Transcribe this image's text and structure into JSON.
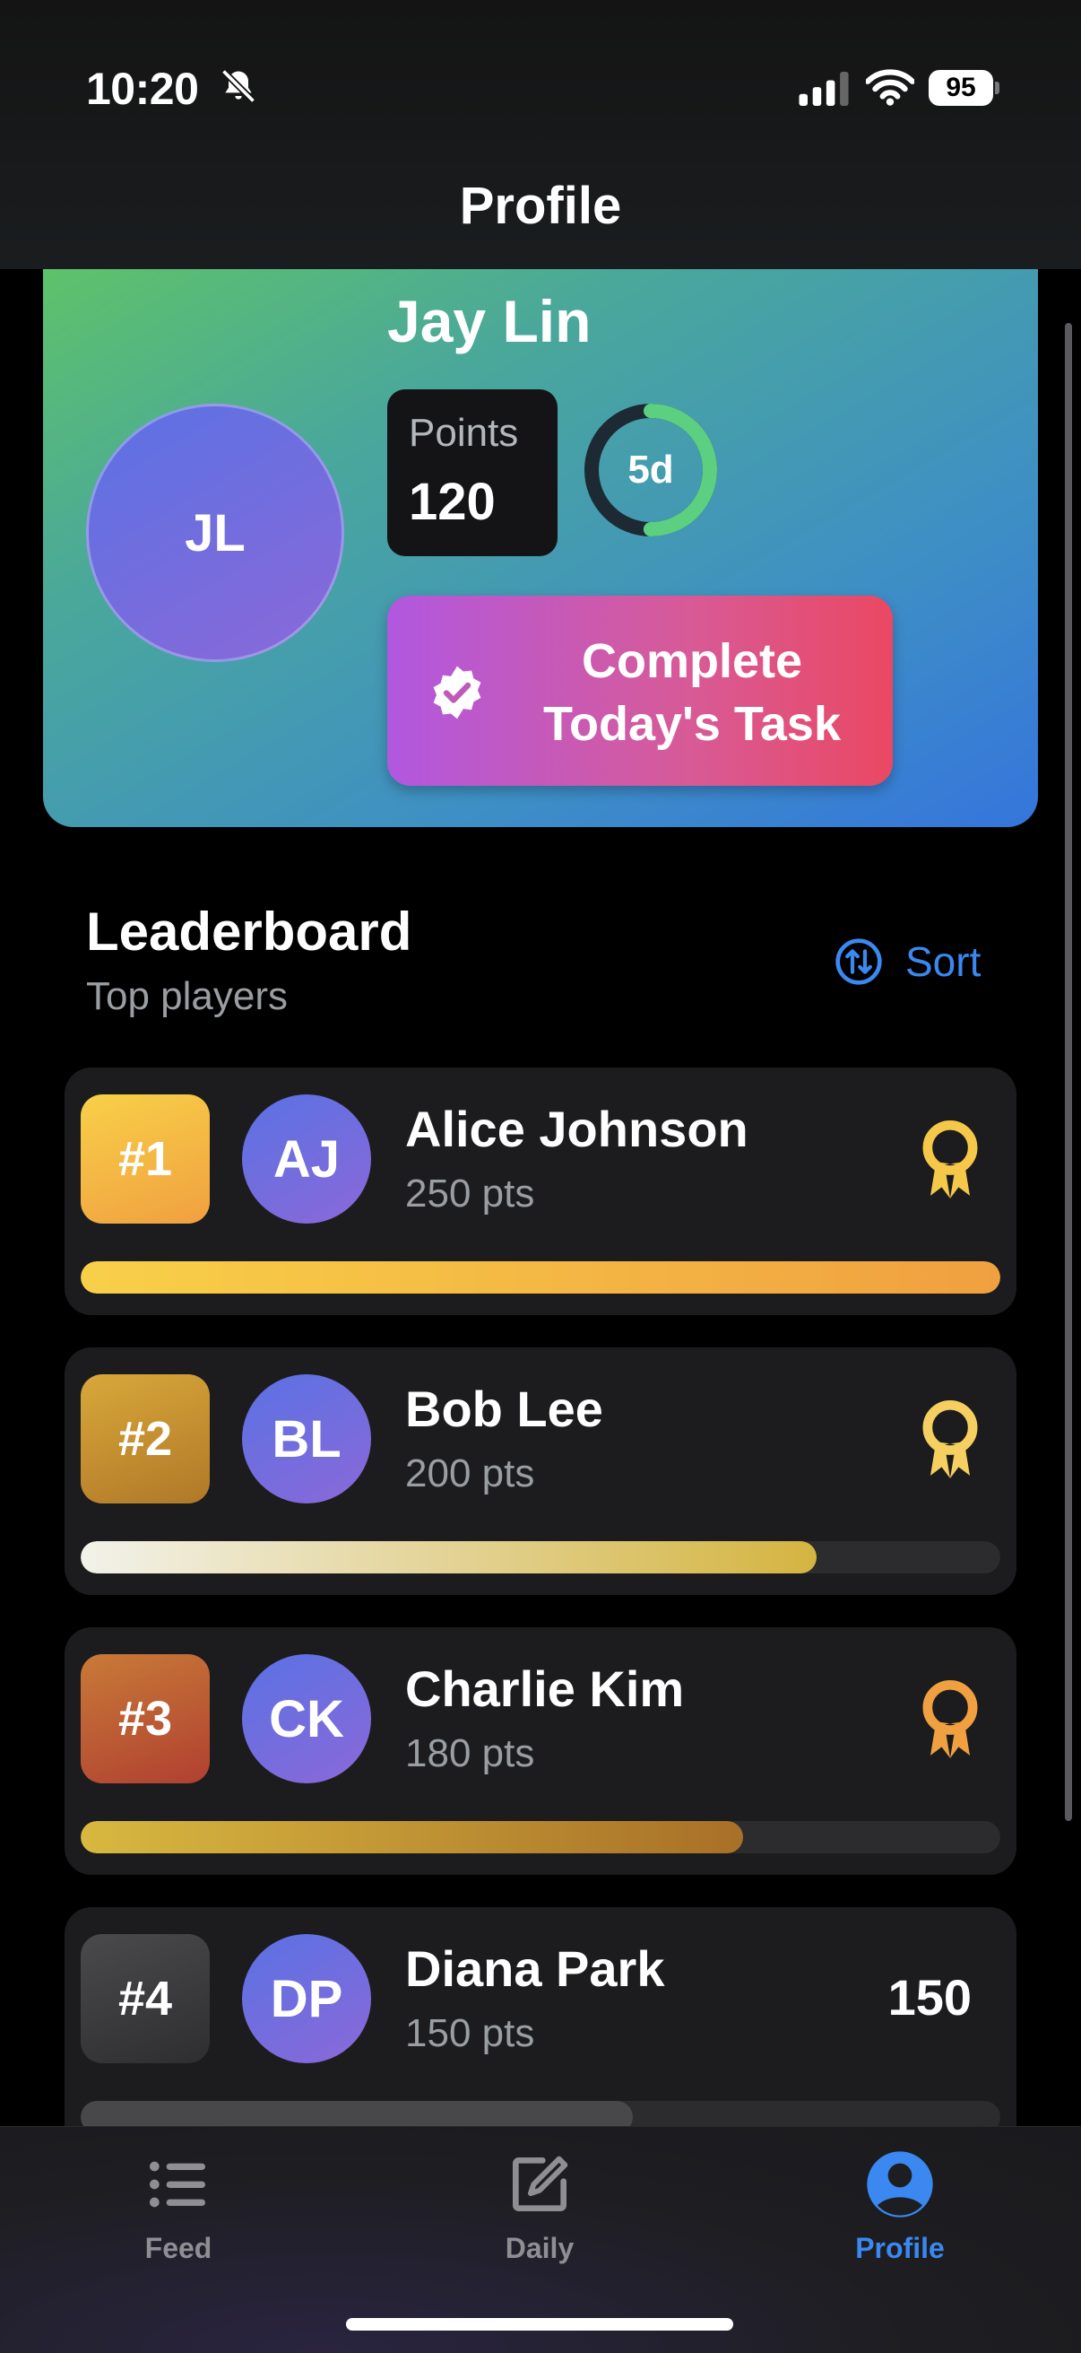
{
  "status": {
    "time": "10:20",
    "battery": "95",
    "icons": [
      "bell-slash-icon",
      "cellular-signal-icon",
      "wifi-icon",
      "battery-icon"
    ]
  },
  "header": {
    "title": "Profile"
  },
  "profile": {
    "initials": "JL",
    "name": "Jay Lin",
    "points_label": "Points",
    "points_value": "120",
    "streak_label": "5d",
    "streak_progress": 0.5,
    "task_button_line1": "Complete",
    "task_button_line2": "Today's Task",
    "task_icon": "verified-badge-icon"
  },
  "leaderboard": {
    "title": "Leaderboard",
    "subtitle": "Top players",
    "sort_label": "Sort",
    "sort_icon": "sort-arrows-icon",
    "players": [
      {
        "rank": "#1",
        "initials": "AJ",
        "name": "Alice Johnson",
        "points": "250 pts",
        "progress": 1.0,
        "badge": "award-icon",
        "badge_color": "#f5c84a"
      },
      {
        "rank": "#2",
        "initials": "BL",
        "name": "Bob Lee",
        "points": "200 pts",
        "progress": 0.8,
        "badge": "award-icon",
        "badge_color": "#f5d060"
      },
      {
        "rank": "#3",
        "initials": "CK",
        "name": "Charlie Kim",
        "points": "180 pts",
        "progress": 0.72,
        "badge": "award-icon",
        "badge_color": "#f0a040"
      },
      {
        "rank": "#4",
        "initials": "DP",
        "name": "Diana Park",
        "points": "150 pts",
        "progress": 0.6,
        "score": "150"
      }
    ]
  },
  "tabs": [
    {
      "label": "Feed",
      "icon": "list-icon",
      "active": false
    },
    {
      "label": "Daily",
      "icon": "compose-icon",
      "active": false
    },
    {
      "label": "Profile",
      "icon": "person-circle-icon",
      "active": true
    }
  ],
  "colors": {
    "accent": "#3a88f0",
    "gold": "#f5c84a",
    "bronze": "#c86438",
    "inactive": "#8e8e93"
  }
}
